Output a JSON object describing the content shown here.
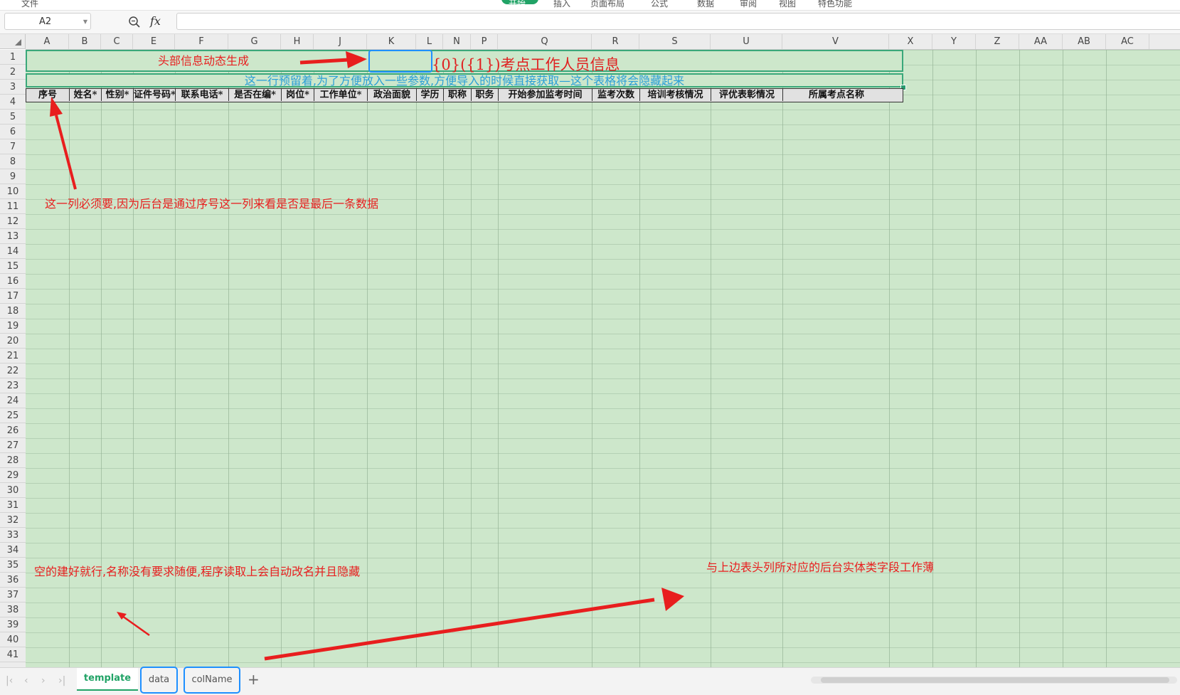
{
  "menu": {
    "items": [
      "文件",
      "开始",
      "插入",
      "页面布局",
      "公式",
      "数据",
      "审阅",
      "视图",
      "特色功能"
    ]
  },
  "formula_bar": {
    "cell_ref": "A2",
    "fx_label": "fx",
    "formula_value": ""
  },
  "columns": [
    "A",
    "B",
    "C",
    "E",
    "F",
    "G",
    "H",
    "J",
    "K",
    "L",
    "N",
    "P",
    "Q",
    "R",
    "S",
    "U",
    "V",
    "X",
    "Y",
    "Z",
    "AA",
    "AB",
    "AC"
  ],
  "rows": [
    "1",
    "2",
    "3",
    "4",
    "5",
    "6",
    "7",
    "8",
    "9",
    "10",
    "11",
    "12",
    "13",
    "14",
    "15",
    "16",
    "17",
    "18",
    "19",
    "20",
    "21",
    "22",
    "23",
    "24",
    "25",
    "26",
    "27",
    "28",
    "29",
    "30",
    "31",
    "32",
    "33",
    "34",
    "35",
    "36",
    "37",
    "38",
    "39",
    "40",
    "41"
  ],
  "sheet": {
    "title_placeholder": "{0}({1})",
    "title_suffix": "考点工作人员信息",
    "param_row_text": "这一行预留着,为了方便放入一些参数,方便导入的时候直接获取—这个表格将会隐藏起来",
    "headers": [
      "序号",
      "姓名*",
      "性别*",
      "证件号码*",
      "联系电话*",
      "是否在编*",
      "岗位*",
      "工作单位*",
      "政治面貌",
      "学历",
      "职称",
      "职务",
      "开始参加监考时间",
      "监考次数",
      "培训考核情况",
      "评优表彰情况",
      "所属考点名称"
    ]
  },
  "annotations": {
    "header_dynamic": "头部信息动态生成",
    "serial_required": "这一列必须要,因为后台是通过序号这一列来看是否是最后一条数据",
    "empty_sheet_note": "空的建好就行,名称没有要求随便,程序读取上会自动改名并且隐藏",
    "colname_note": "与上边表头列所对应的后台实体类字段工作薄"
  },
  "tabs": [
    {
      "label": "template",
      "active": true
    },
    {
      "label": "data",
      "active": false
    },
    {
      "label": "colName",
      "active": false
    }
  ],
  "colors": {
    "cell_bg": "#cde7cb",
    "accent_green": "#21a366",
    "annotation_red": "#e81e1e",
    "highlight_blue": "#1e90ff",
    "param_text_blue": "#2a9fd8"
  }
}
